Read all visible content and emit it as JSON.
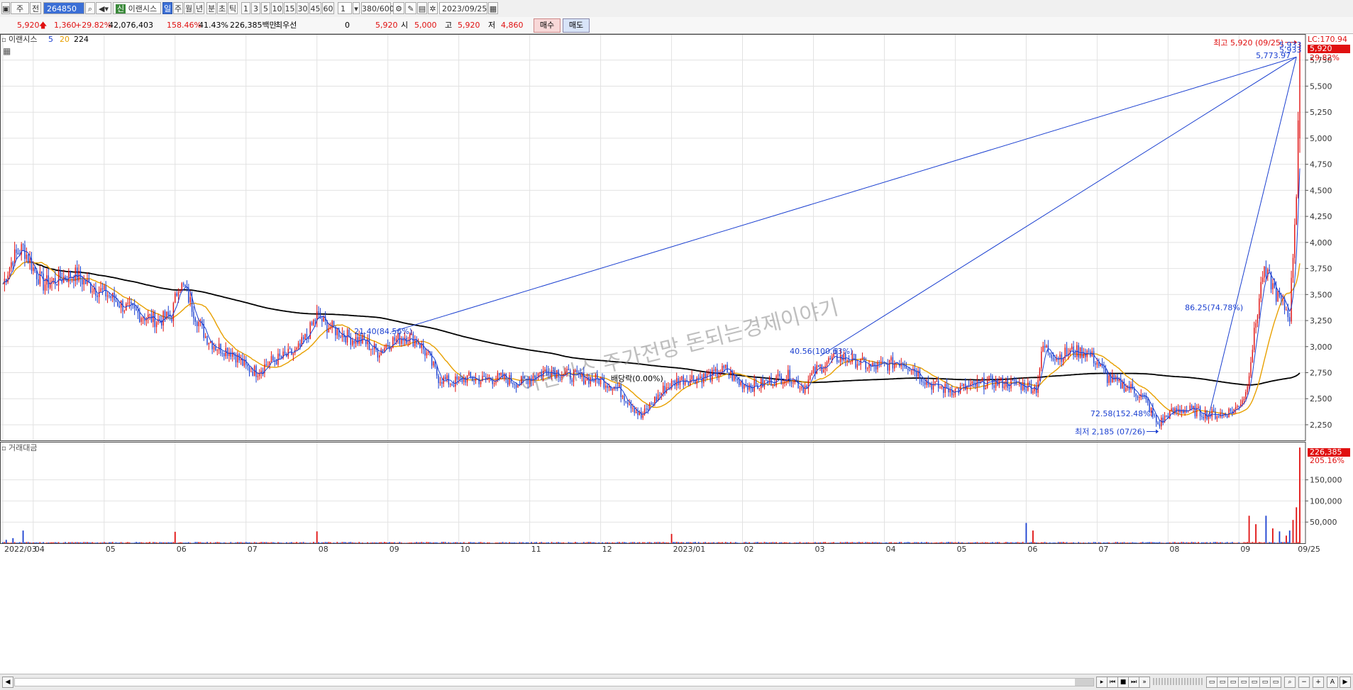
{
  "toolbar": {
    "market_label": "주",
    "market_type": "전",
    "code": "264850",
    "name": "이랜시스",
    "periods": [
      "일",
      "주",
      "월",
      "년",
      "분",
      "초",
      "틱"
    ],
    "active_period": "일",
    "intervals": [
      "1",
      "3",
      "5",
      "10",
      "15",
      "30",
      "45",
      "60"
    ],
    "step": "1",
    "count": "380/600",
    "date": "2023/09/25"
  },
  "quote": {
    "price": "5,920",
    "change": "1,360",
    "change_pct": "+29.82%",
    "volume": "42,076,403",
    "volume_ratio": "158.46%",
    "turnover_rate": "41.43%",
    "amount": "226,385백만",
    "best_ask_label": "최우선",
    "best_ask_qty": "0",
    "best_ask_price": "5,920",
    "open_label": "시",
    "open": "5,000",
    "high_label": "고",
    "high": "5,920",
    "low_label": "저",
    "low": "4,860",
    "buy_label": "매수",
    "sell_label": "매도",
    "up_color": "#e01010",
    "down_color": "#1a3fd0"
  },
  "chart_data": [
    {
      "type": "candlestick",
      "name": "이랜시스",
      "ma_labels": [
        "5",
        "20",
        "224"
      ],
      "ma_colors": [
        "#1a3fd0",
        "#e8a000",
        "#000000"
      ],
      "ylim": [
        2100,
        6000
      ],
      "y_ticks": [
        2250,
        2500,
        2750,
        3000,
        3250,
        3500,
        3750,
        4000,
        4250,
        4500,
        4750,
        5000,
        5250,
        5500,
        5750
      ],
      "y_tick_labels": [
        "2,250",
        "2,500",
        "2,750",
        "3,000",
        "3,250",
        "3,500",
        "3,750",
        "4,000",
        "4,250",
        "4,500",
        "4,750",
        "5,000",
        "5,250",
        "5,500",
        "5,750"
      ],
      "x_tick_labels": [
        "2022/03",
        "04",
        "05",
        "06",
        "07",
        "08",
        "09",
        "10",
        "11",
        "12",
        "2023/01",
        "02",
        "03",
        "04",
        "05",
        "06",
        "07",
        "08",
        "09",
        "09/25"
      ],
      "x_tick_days": [
        0,
        18,
        60,
        102,
        144,
        186,
        228,
        270,
        312,
        354,
        396,
        438,
        480,
        522,
        564,
        606,
        648,
        690,
        732,
        766
      ],
      "anchors": [
        [
          0,
          3600
        ],
        [
          6,
          3850
        ],
        [
          12,
          3950
        ],
        [
          18,
          3750
        ],
        [
          24,
          3600
        ],
        [
          32,
          3640
        ],
        [
          42,
          3700
        ],
        [
          52,
          3580
        ],
        [
          62,
          3500
        ],
        [
          72,
          3380
        ],
        [
          82,
          3300
        ],
        [
          92,
          3250
        ],
        [
          100,
          3300
        ],
        [
          104,
          3600
        ],
        [
          108,
          3550
        ],
        [
          114,
          3300
        ],
        [
          120,
          3100
        ],
        [
          126,
          3000
        ],
        [
          136,
          2950
        ],
        [
          144,
          2800
        ],
        [
          150,
          2760
        ],
        [
          158,
          2850
        ],
        [
          166,
          2900
        ],
        [
          174,
          2950
        ],
        [
          180,
          3100
        ],
        [
          186,
          3300
        ],
        [
          192,
          3200
        ],
        [
          198,
          3150
        ],
        [
          206,
          3080
        ],
        [
          214,
          3050
        ],
        [
          222,
          2950
        ],
        [
          230,
          3050
        ],
        [
          238,
          3100
        ],
        [
          246,
          3050
        ],
        [
          252,
          2900
        ],
        [
          258,
          2700
        ],
        [
          266,
          2650
        ],
        [
          274,
          2700
        ],
        [
          284,
          2680
        ],
        [
          296,
          2700
        ],
        [
          306,
          2650
        ],
        [
          314,
          2720
        ],
        [
          324,
          2780
        ],
        [
          334,
          2730
        ],
        [
          344,
          2700
        ],
        [
          354,
          2680
        ],
        [
          364,
          2600
        ],
        [
          372,
          2450
        ],
        [
          378,
          2320
        ],
        [
          384,
          2450
        ],
        [
          392,
          2600
        ],
        [
          400,
          2680
        ],
        [
          410,
          2700
        ],
        [
          420,
          2720
        ],
        [
          428,
          2780
        ],
        [
          436,
          2650
        ],
        [
          446,
          2620
        ],
        [
          456,
          2680
        ],
        [
          466,
          2720
        ],
        [
          474,
          2600
        ],
        [
          480,
          2750
        ],
        [
          488,
          2850
        ],
        [
          496,
          2900
        ],
        [
          504,
          2870
        ],
        [
          514,
          2800
        ],
        [
          522,
          2820
        ],
        [
          532,
          2860
        ],
        [
          540,
          2780
        ],
        [
          548,
          2650
        ],
        [
          556,
          2600
        ],
        [
          564,
          2580
        ],
        [
          574,
          2620
        ],
        [
          584,
          2660
        ],
        [
          594,
          2650
        ],
        [
          604,
          2630
        ],
        [
          612,
          2600
        ],
        [
          616,
          3000
        ],
        [
          624,
          2900
        ],
        [
          632,
          2950
        ],
        [
          642,
          2950
        ],
        [
          648,
          2850
        ],
        [
          654,
          2700
        ],
        [
          660,
          2650
        ],
        [
          668,
          2600
        ],
        [
          676,
          2500
        ],
        [
          684,
          2250
        ],
        [
          690,
          2350
        ],
        [
          698,
          2400
        ],
        [
          706,
          2380
        ],
        [
          714,
          2350
        ],
        [
          722,
          2350
        ],
        [
          730,
          2400
        ],
        [
          736,
          2550
        ],
        [
          740,
          3000
        ],
        [
          746,
          3700
        ],
        [
          750,
          3650
        ],
        [
          754,
          3500
        ],
        [
          758,
          3400
        ],
        [
          762,
          3300
        ],
        [
          766,
          4500
        ],
        [
          768,
          5920
        ]
      ],
      "last_candle": {
        "open": 5000,
        "high": 5920,
        "low": 4860,
        "close": 5920
      },
      "annotations": [
        {
          "text": "최고 5,920 (09/25)",
          "color": "red",
          "day": 766,
          "value": 5920
        },
        {
          "text": "최저 2,185 (07/26)",
          "color": "blue",
          "day": 684,
          "value": 2185
        },
        {
          "text": "21.40(84.56%)",
          "color": "blue",
          "day": 208,
          "value": 3120
        },
        {
          "text": "40.56(100.63%)",
          "color": "blue",
          "day": 466,
          "value": 2930
        },
        {
          "text": "배당락(0.00%)",
          "color": "black",
          "day": 360,
          "value": 2670
        },
        {
          "text": "72.58(152.48%)",
          "color": "blue",
          "day": 644,
          "value": 2330
        },
        {
          "text": "86.25(74.78%)",
          "color": "blue",
          "day": 700,
          "value": 3350
        },
        {
          "text": "5,773.97",
          "color": "blue",
          "day": 742,
          "value": 5770
        }
      ],
      "trend_lines": [
        {
          "from": [
            230,
            3140
          ],
          "to": [
            766,
            5780
          ]
        },
        {
          "from": [
            484,
            2910
          ],
          "to": [
            766,
            5780
          ]
        },
        {
          "from": [
            714,
            2330
          ],
          "to": [
            766,
            5780
          ]
        }
      ],
      "right_labels": {
        "lc": "LC:170.94",
        "price": "5,920",
        "pct": "29.82%",
        "top": "5,933",
        "top2": "5,933"
      },
      "watermark": "이랜시스 주가전망 돈되는경제이야기"
    },
    {
      "type": "bar",
      "name": "거래대금",
      "ylim": [
        0,
        240000
      ],
      "y_ticks": [
        50000,
        100000,
        150000
      ],
      "y_tick_labels": [
        "50,000",
        "100,000",
        "150,000"
      ],
      "spikes": [
        [
          2,
          8000
        ],
        [
          6,
          12000
        ],
        [
          12,
          30000
        ],
        [
          102,
          27000
        ],
        [
          186,
          28000
        ],
        [
          396,
          22000
        ],
        [
          606,
          48000
        ],
        [
          610,
          30000
        ],
        [
          738,
          65000
        ],
        [
          742,
          45000
        ],
        [
          748,
          65000
        ],
        [
          752,
          35000
        ],
        [
          756,
          28000
        ],
        [
          760,
          18000
        ],
        [
          762,
          30000
        ],
        [
          764,
          55000
        ],
        [
          766,
          85000
        ],
        [
          768,
          226385
        ]
      ],
      "right_labels": {
        "amount": "226,385",
        "pct": "205.16%"
      }
    }
  ]
}
